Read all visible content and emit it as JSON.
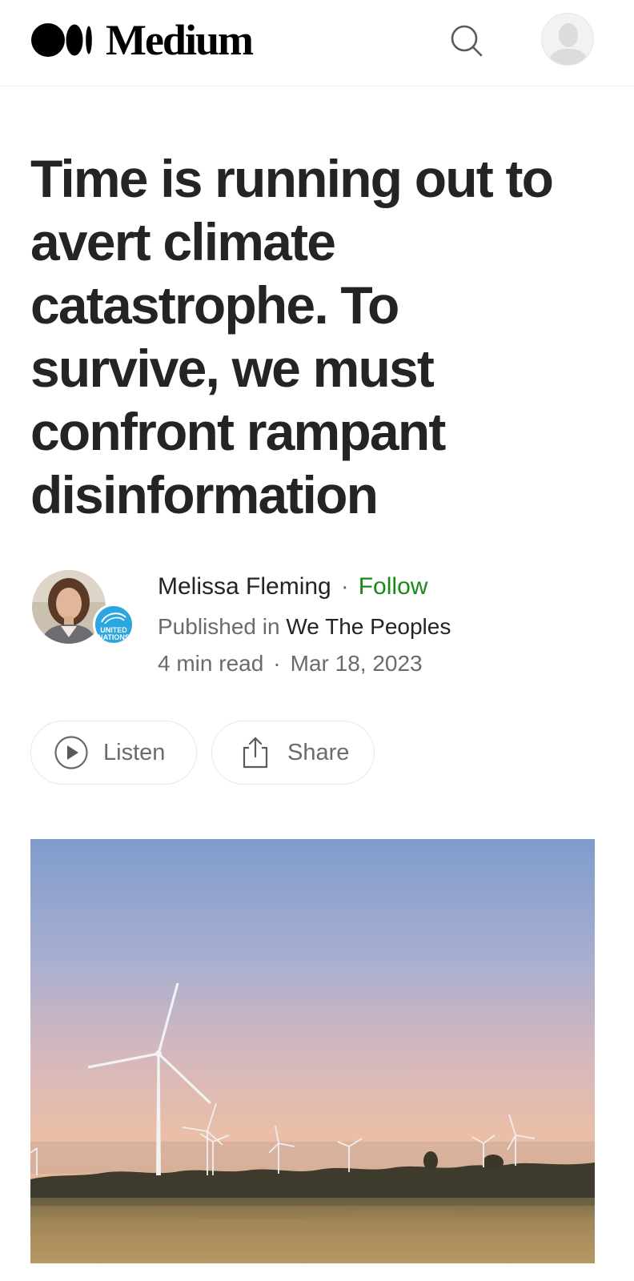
{
  "header": {
    "brand": "Medium",
    "icons": {
      "logo": "medium-logo-icon",
      "search": "search-icon",
      "avatar": "user-avatar-icon"
    }
  },
  "article": {
    "title": "Time is running out to avert climate catastrophe. To survive, we must confront rampant disinformation",
    "author": "Melissa Fleming",
    "separator": "·",
    "follow_label": "Follow",
    "published_prefix": "Published in",
    "publication": "We The Peoples",
    "publication_badge_text": "UNITED NATIONS",
    "read_time": "4 min read",
    "date": "Mar 18, 2023"
  },
  "actions": {
    "listen_label": "Listen",
    "share_label": "Share",
    "icons": {
      "listen": "play-circle-icon",
      "share": "share-icon"
    }
  },
  "colors": {
    "accent_green": "#1a8917",
    "text_primary": "#242424",
    "text_secondary": "#6b6b6b",
    "un_blue": "#2aa6e0"
  }
}
